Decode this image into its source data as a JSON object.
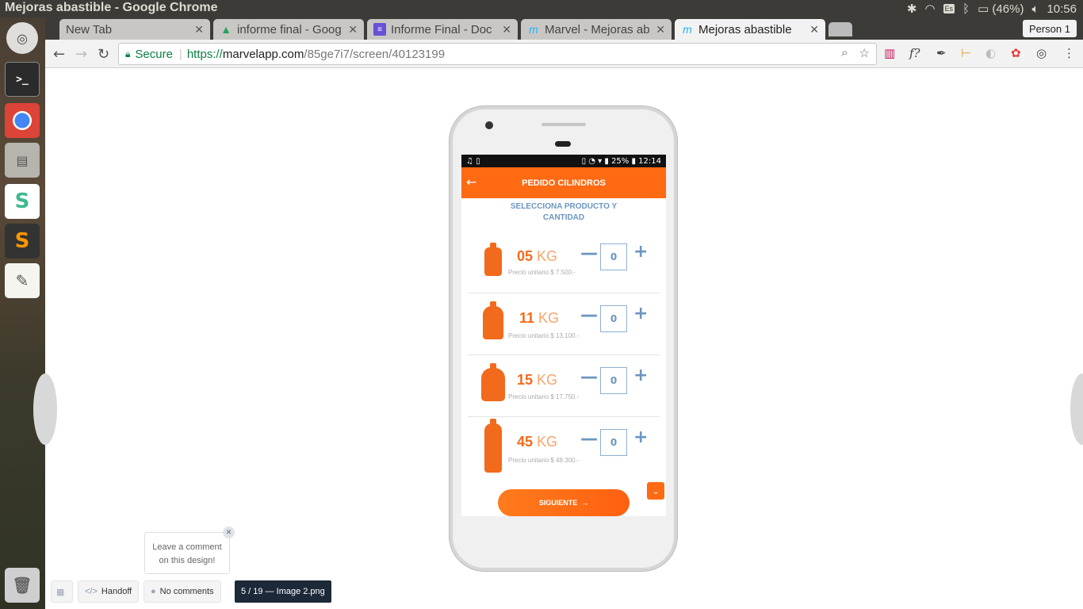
{
  "window": {
    "title": "Mejoras abastible - Google Chrome"
  },
  "tray": {
    "keyboard": "Es",
    "battery": "(46%)",
    "time": "10:56"
  },
  "tabs": [
    {
      "label": "New Tab",
      "icon": "none"
    },
    {
      "label": "informe final - Goog",
      "icon": "drive-icon"
    },
    {
      "label": "Informe Final - Doc",
      "icon": "docs-icon"
    },
    {
      "label": "Marvel - Mejoras ab",
      "icon": "marvel-icon"
    },
    {
      "label": "Mejoras abastible",
      "icon": "marvel-icon"
    }
  ],
  "person": "Person 1",
  "omnibox": {
    "secure": "Secure",
    "scheme": "https://",
    "host": "marvelapp.com",
    "path": "/85ge7i7/screen/40123199"
  },
  "phone": {
    "status_time": "12:14",
    "status_battery": "25%",
    "app_title": "PEDIDO CILINDROS",
    "subtitle_1": "SELECCIONA PRODUCTO Y",
    "subtitle_2": "CANTIDAD",
    "products": [
      {
        "num": "05",
        "unit": "KG",
        "price": "Precio unitario $ 7.500.-",
        "qty": "0"
      },
      {
        "num": "11",
        "unit": "KG",
        "price": "Precio unitario $ 13.100.-",
        "qty": "0"
      },
      {
        "num": "15",
        "unit": "KG",
        "price": "Precio unitario $ 17.750.-",
        "qty": "0"
      },
      {
        "num": "45",
        "unit": "KG",
        "price": "Precio unitario $ 48.300.-",
        "qty": "0"
      }
    ],
    "next_label": "SIGUIENTE",
    "minus": "—",
    "plus": "+"
  },
  "marvel": {
    "comment_line1": "Leave a comment",
    "comment_line2": "on this design!",
    "handoff": "Handoff",
    "comments": "No comments",
    "counter": "5 / 19 — Image 2.png"
  },
  "colors": {
    "accent": "#ff6a13",
    "blue": "#6b95c0"
  }
}
